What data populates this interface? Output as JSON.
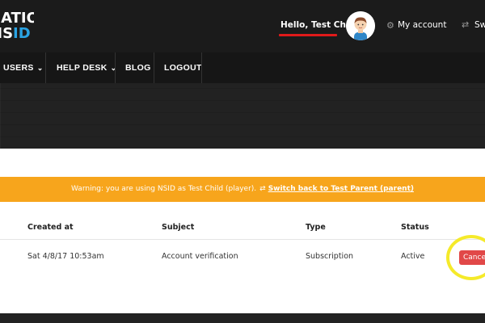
{
  "header": {
    "logo_line1": "NATIONAL",
    "logo_line2_a": "NS",
    "logo_line2_b": "ID",
    "greeting": "Hello, Test Child",
    "my_account": "My account",
    "switch": "Switch"
  },
  "nav": {
    "items": [
      {
        "label": "USERS",
        "has_dropdown": true
      },
      {
        "label": "HELP DESK",
        "has_dropdown": true
      },
      {
        "label": "BLOG",
        "has_dropdown": false
      },
      {
        "label": "LOGOUT",
        "has_dropdown": false
      }
    ]
  },
  "warning": {
    "text": "Warning: you are using NSID as Test Child (player).",
    "link": "Switch back to Test Parent (parent)"
  },
  "table": {
    "headers": [
      "Created at",
      "Subject",
      "Type",
      "Status"
    ],
    "rows": [
      {
        "created_at": "Sat 4/8/17 10:53am",
        "subject": "Account verification",
        "type": "Subscription",
        "status": "Active",
        "action": "Cancel"
      }
    ]
  },
  "colors": {
    "warning_bg": "#f7a51c",
    "cancel_bg": "#e14848",
    "highlight": "#f5ea2a",
    "underline": "#e01a1a",
    "logo_accent": "#2aa3e3"
  }
}
